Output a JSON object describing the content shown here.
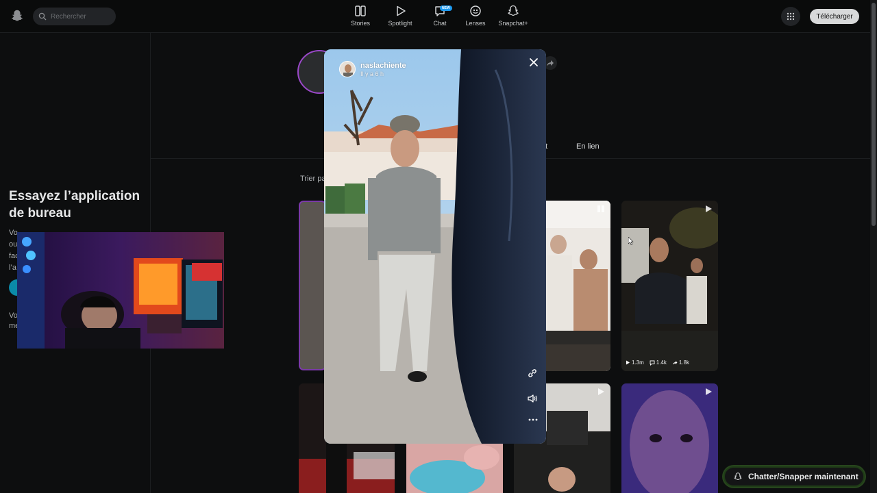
{
  "header": {
    "search_placeholder": "Rechercher",
    "nav": [
      {
        "label": "Stories",
        "icon": "stories-icon"
      },
      {
        "label": "Spotlight",
        "icon": "spotlight-icon"
      },
      {
        "label": "Chat",
        "icon": "chat-icon",
        "badge": "NEW"
      },
      {
        "label": "Lenses",
        "icon": "lenses-icon"
      },
      {
        "label": "Snapchat+",
        "icon": "snapchat-plus-icon"
      }
    ],
    "download_label": "Télécharger"
  },
  "sidebar": {
    "promo_title": "Essayez l’application de bureau",
    "promo_text_fragments": [
      "Vo",
      "ou",
      "fac",
      "l’a"
    ],
    "promo_text2_fragments": [
      "Vo",
      "me"
    ]
  },
  "profile": {
    "tab_partial": "nt",
    "tab_links": "En lien",
    "sort_label": "Trier pa"
  },
  "tiles": [
    {
      "stats": {
        "views": "1.3m",
        "comments": "1.4k",
        "shares": "1.8k"
      }
    }
  ],
  "viewer": {
    "username": "naslachiente",
    "time": "Il y a 6 h"
  },
  "chat_cta": "Chatter/Snapper maintenant",
  "colors": {
    "accent_purple": "#9a48c8",
    "chat_glow": "#27451d",
    "background": "#0d0e0f"
  }
}
